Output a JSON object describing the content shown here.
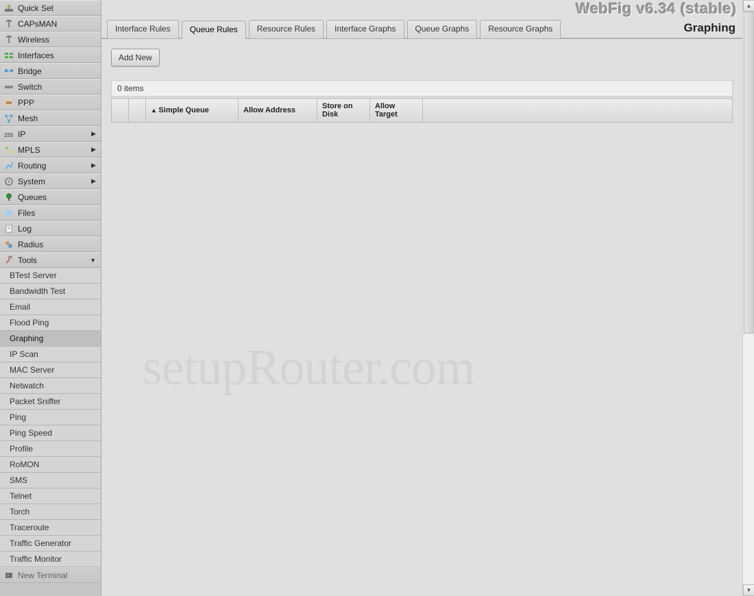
{
  "header": {
    "title": "WebFig v6.34 (stable)",
    "page_title": "Graphing"
  },
  "sidebar": {
    "items": [
      {
        "id": "quickset",
        "label": "Quick Set",
        "icon": "quickset-icon",
        "submenu": false
      },
      {
        "id": "capsman",
        "label": "CAPsMAN",
        "icon": "antenna-icon",
        "submenu": false
      },
      {
        "id": "wireless",
        "label": "Wireless",
        "icon": "antenna-icon",
        "submenu": false
      },
      {
        "id": "interfaces",
        "label": "Interfaces",
        "icon": "interfaces-icon",
        "submenu": false
      },
      {
        "id": "bridge",
        "label": "Bridge",
        "icon": "bridge-icon",
        "submenu": false
      },
      {
        "id": "switch",
        "label": "Switch",
        "icon": "switch-icon",
        "submenu": false
      },
      {
        "id": "ppp",
        "label": "PPP",
        "icon": "ppp-icon",
        "submenu": false
      },
      {
        "id": "mesh",
        "label": "Mesh",
        "icon": "mesh-icon",
        "submenu": false
      },
      {
        "id": "ip",
        "label": "IP",
        "icon": "ip-icon",
        "submenu": true
      },
      {
        "id": "mpls",
        "label": "MPLS",
        "icon": "mpls-icon",
        "submenu": true
      },
      {
        "id": "routing",
        "label": "Routing",
        "icon": "routing-icon",
        "submenu": true
      },
      {
        "id": "system",
        "label": "System",
        "icon": "system-icon",
        "submenu": true
      },
      {
        "id": "queues",
        "label": "Queues",
        "icon": "queues-icon",
        "submenu": false
      },
      {
        "id": "files",
        "label": "Files",
        "icon": "files-icon",
        "submenu": false
      },
      {
        "id": "log",
        "label": "Log",
        "icon": "log-icon",
        "submenu": false
      },
      {
        "id": "radius",
        "label": "Radius",
        "icon": "radius-icon",
        "submenu": false
      },
      {
        "id": "tools",
        "label": "Tools",
        "icon": "tools-icon",
        "submenu": true,
        "expanded": true
      },
      {
        "id": "newterminal",
        "label": "New Terminal",
        "icon": "terminal-icon",
        "submenu": false
      }
    ],
    "tools_submenu": [
      "BTest Server",
      "Bandwidth Test",
      "Email",
      "Flood Ping",
      "Graphing",
      "IP Scan",
      "MAC Server",
      "Netwatch",
      "Packet Sniffer",
      "Ping",
      "Ping Speed",
      "Profile",
      "RoMON",
      "SMS",
      "Telnet",
      "Torch",
      "Traceroute",
      "Traffic Generator",
      "Traffic Monitor"
    ],
    "tools_active": "Graphing"
  },
  "tabs": [
    {
      "id": "interface_rules",
      "label": "Interface Rules"
    },
    {
      "id": "queue_rules",
      "label": "Queue Rules"
    },
    {
      "id": "resource_rules",
      "label": "Resource Rules"
    },
    {
      "id": "interface_graphs",
      "label": "Interface Graphs"
    },
    {
      "id": "queue_graphs",
      "label": "Queue Graphs"
    },
    {
      "id": "resource_graphs",
      "label": "Resource Graphs"
    }
  ],
  "tabs_active": "queue_rules",
  "toolbar": {
    "add_new_label": "Add New"
  },
  "table": {
    "count_label": "0 items",
    "columns": [
      "Simple Queue",
      "Allow Address",
      "Store on Disk",
      "Allow Target"
    ],
    "rows": []
  },
  "watermark": "setupRouter.com"
}
